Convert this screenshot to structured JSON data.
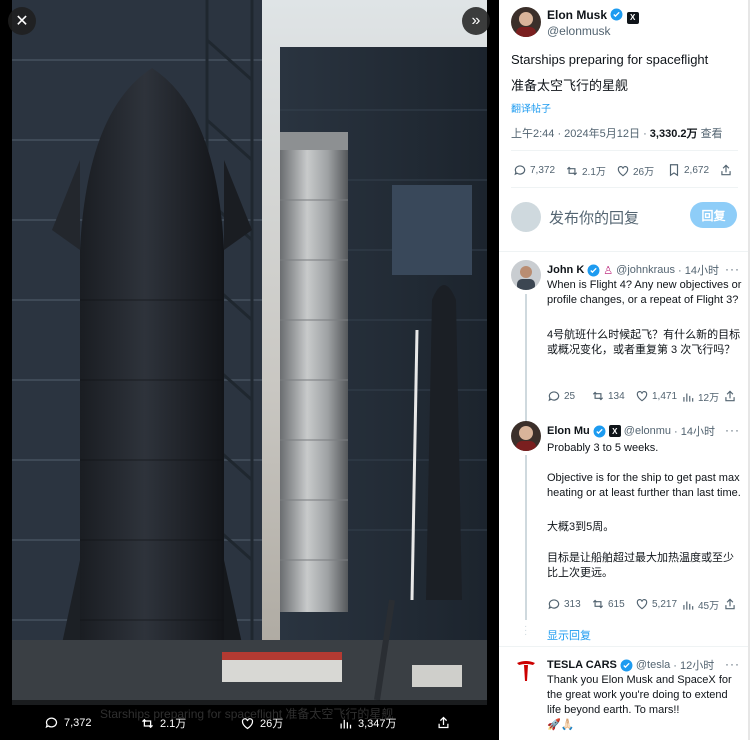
{
  "media": {
    "close_icon": "close-icon",
    "expand_icon": "double-chevron-right-icon",
    "caption_ghost": "Starships preparing for spaceflight 准备太空飞行的星舰",
    "actions": {
      "replies": "7,372",
      "reposts": "2.1万",
      "likes": "26万",
      "views": "3,347万"
    }
  },
  "tweet": {
    "author_name": "Elon Musk",
    "author_handle": "@elonmusk",
    "text_en": "Starships preparing for spaceflight",
    "text_zh": "准备太空飞行的星舰",
    "translate": "翻译帖子",
    "time": "上午2:44 · 2024年5月12日 ·",
    "views_count": "3,330.2万",
    "views_label": "查看",
    "stats": {
      "replies": "7,372",
      "reposts": "2.1万",
      "likes": "26万",
      "bookmarks": "2,672"
    }
  },
  "composer": {
    "placeholder": "发布你的回复",
    "button": "回复"
  },
  "replies": [
    {
      "name": "John K",
      "handle": "@johnkraus",
      "time": "· 14小时",
      "text_en": "When is Flight 4? Any new objectives or profile changes, or a repeat of Flight 3?",
      "text_zh": "4号航班什么时候起飞？有什么新的目标或概况变化，或者重复第 3 次飞行吗？",
      "stats": {
        "replies": "25",
        "reposts": "134",
        "likes": "1,471",
        "views": "12万"
      }
    },
    {
      "name": "Elon Mu",
      "handle": "@elonmu",
      "time": "· 14小时",
      "text_en_1": "Probably 3 to 5 weeks.",
      "text_en_2": "Objective is for the ship to get past max heating or at least further than last time.",
      "text_zh_1": "大概3到5周。",
      "text_zh_2": "目标是让船舶超过最大加热温度或至少比上次更远。",
      "stats": {
        "replies": "313",
        "reposts": "615",
        "likes": "5,217",
        "views": "45万"
      }
    },
    {
      "name": "TESLA CARS",
      "handle": "@tesla",
      "time": "· 12小时",
      "text_en": "Thank you Elon Musk and SpaceX for the great work you're doing to extend life beyond earth. To mars!!"
    }
  ],
  "show_replies": "显示回复",
  "colors": {
    "accent": "#1d9bf0",
    "verified": "#1d9bf0",
    "reply_button": "#8ecdf8",
    "text": "#0f1419",
    "muted": "#536471"
  }
}
